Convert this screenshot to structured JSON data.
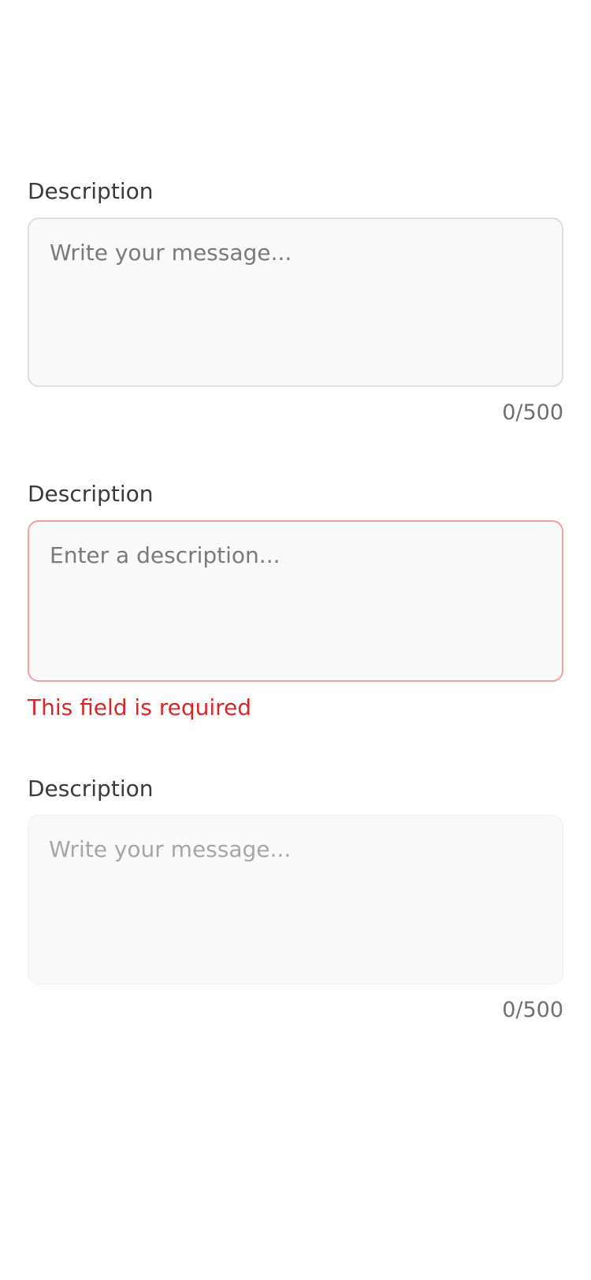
{
  "fields": [
    {
      "label": "Description",
      "placeholder": "Write your message...",
      "value": "",
      "counter": "0/500",
      "state": "default"
    },
    {
      "label": "Description",
      "placeholder": "Enter a description...",
      "value": "",
      "error": "This field is required",
      "state": "error",
      "border_color": "#f3a0a0",
      "error_color": "#d9262a"
    },
    {
      "label": "Description",
      "placeholder": "Write your message...",
      "value": "",
      "counter": "0/500",
      "state": "disabled"
    }
  ]
}
